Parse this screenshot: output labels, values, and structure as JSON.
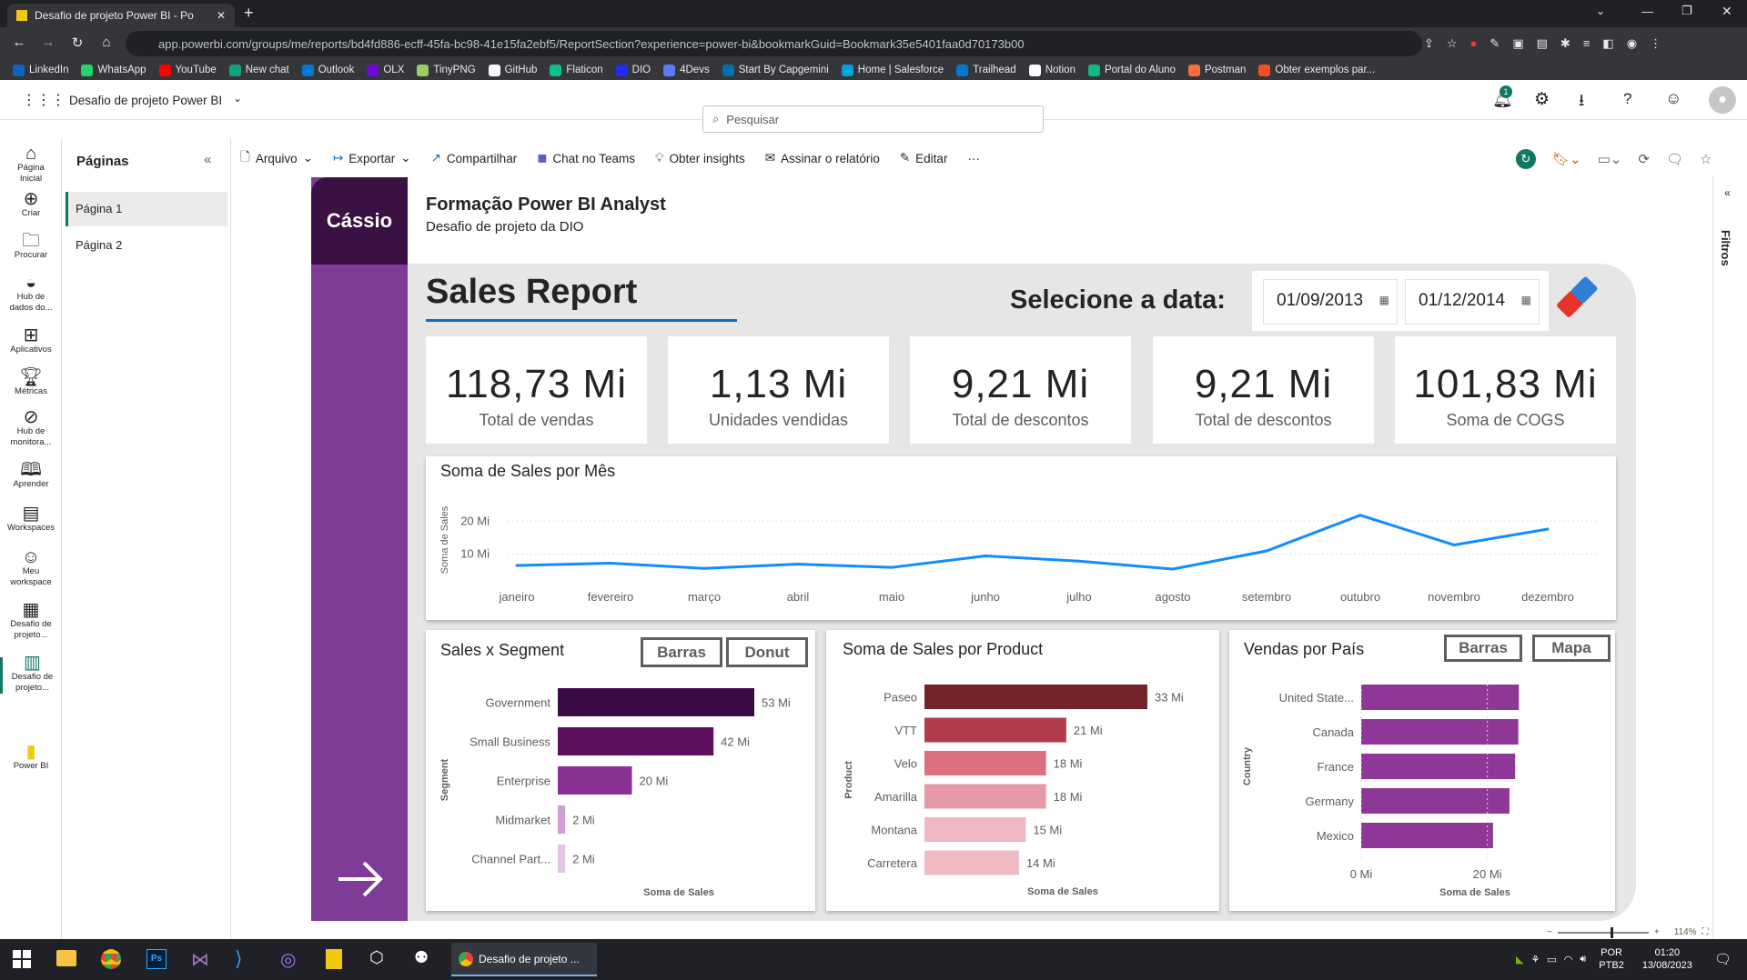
{
  "browser": {
    "tab_title": "Desafio de projeto Power BI - Po",
    "url": "app.powerbi.com/groups/me/reports/bd4fd886-ecff-45fa-bc98-41e15fa2ebf5/ReportSection?experience=power-bi&bookmarkGuid=Bookmark35e5401faa0d70173b00",
    "bookmarks": [
      "LinkedIn",
      "WhatsApp",
      "YouTube",
      "New chat",
      "Outlook",
      "OLX",
      "TinyPNG",
      "GitHub",
      "Flaticon",
      "DIO",
      "4Devs",
      "Start By Capgemini",
      "Home | Salesforce",
      "Trailhead",
      "Notion",
      "Portal do Aluno",
      "Postman",
      "Obter exemplos par..."
    ]
  },
  "pbi": {
    "workspace_title": "Desafio de projeto Power BI",
    "search_placeholder": "Pesquisar",
    "notif_count": "1"
  },
  "rail": [
    {
      "label": "Página Inicial",
      "icon": "home-icon"
    },
    {
      "label": "Criar",
      "icon": "plus-icon"
    },
    {
      "label": "Procurar",
      "icon": "folder-icon"
    },
    {
      "label": "Hub de dados do...",
      "icon": "datahub-icon"
    },
    {
      "label": "Aplicativos",
      "icon": "apps-icon"
    },
    {
      "label": "Métricas",
      "icon": "trophy-icon"
    },
    {
      "label": "Hub de monitora...",
      "icon": "monitor-icon"
    },
    {
      "label": "Aprender",
      "icon": "book-icon"
    },
    {
      "label": "Workspaces",
      "icon": "workspaces-icon"
    },
    {
      "label": "Meu workspace",
      "icon": "user-icon"
    },
    {
      "label": "Desafio de projeto...",
      "icon": "dataset-icon"
    },
    {
      "label": "Desafio de projeto...",
      "icon": "report-icon"
    },
    {
      "label": "Power BI",
      "icon": "powerbi-icon"
    }
  ],
  "pages_pane": {
    "title": "Páginas",
    "pages": [
      "Página 1",
      "Página 2"
    ]
  },
  "toolbar": {
    "arquivo": "Arquivo",
    "exportar": "Exportar",
    "compartilhar": "Compartilhar",
    "chat": "Chat no Teams",
    "insights": "Obter insights",
    "assinar": "Assinar o relatório",
    "editar": "Editar",
    "more": "···"
  },
  "report": {
    "logo_text": "Cássio",
    "header_title": "Formação Power BI Analyst",
    "header_subtitle": "Desafio de projeto da DIO",
    "title": "Sales Report",
    "date_label": "Selecione a data:",
    "date_start": "01/09/2013",
    "date_end": "01/12/2014",
    "kpis": [
      {
        "value": "118,73 Mi",
        "label": "Total de vendas"
      },
      {
        "value": "1,13 Mi",
        "label": "Unidades vendidas"
      },
      {
        "value": "9,21 Mi",
        "label": "Total de descontos"
      },
      {
        "value": "9,21 Mi",
        "label": "Total de descontos"
      },
      {
        "value": "101,83 Mi",
        "label": "Soma de COGS"
      }
    ],
    "btn_barras": "Barras",
    "btn_donut": "Donut",
    "btn_barras2": "Barras",
    "btn_mapa": "Mapa"
  },
  "chart_data": [
    {
      "type": "line",
      "title": "Soma de Sales por Mês",
      "ylabel": "Soma de Sales",
      "xlabel": "",
      "ytick_labels": [
        "10 Mi",
        "20 Mi"
      ],
      "ylim": [
        0,
        22
      ],
      "categories": [
        "janeiro",
        "fevereiro",
        "março",
        "abril",
        "maio",
        "junho",
        "julho",
        "agosto",
        "setembro",
        "outubro",
        "novembro",
        "dezembro"
      ],
      "values": [
        6.6,
        7.3,
        5.7,
        7.0,
        6.0,
        9.5,
        7.9,
        5.5,
        11.0,
        21.8,
        12.8,
        17.6
      ],
      "color": "#118dff"
    },
    {
      "type": "bar",
      "title": "Sales x Segment",
      "ylabel": "Segment",
      "xlabel": "Soma de Sales",
      "categories": [
        "Government",
        "Small Business",
        "Enterprise",
        "Midmarket",
        "Channel Part..."
      ],
      "values": [
        53,
        42,
        20,
        2,
        2
      ],
      "data_labels": [
        "53 Mi",
        "42 Mi",
        "20 Mi",
        "2 Mi",
        "2 Mi"
      ],
      "colors": [
        "#3b0a45",
        "#5b0f5c",
        "#8a3293",
        "#d29ed6",
        "#e3c5e6"
      ]
    },
    {
      "type": "bar",
      "title": "Soma de Sales por Product",
      "ylabel": "Product",
      "xlabel": "Soma de Sales",
      "categories": [
        "Paseo",
        "VTT",
        "Velo",
        "Amarilla",
        "Montana",
        "Carretera"
      ],
      "values": [
        33,
        21,
        18,
        18,
        15,
        14
      ],
      "data_labels": [
        "33 Mi",
        "21 Mi",
        "18 Mi",
        "18 Mi",
        "15 Mi",
        "14 Mi"
      ],
      "colors": [
        "#74232b",
        "#b33c4c",
        "#de6f7e",
        "#e69aa5",
        "#efb8c0",
        "#f0bcc3"
      ]
    },
    {
      "type": "bar",
      "title": "Vendas por País",
      "ylabel": "Country",
      "xlabel": "Soma de Sales",
      "categories": [
        "United State...",
        "Canada",
        "France",
        "Germany",
        "Mexico"
      ],
      "values": [
        25.0,
        24.9,
        24.4,
        23.5,
        20.9
      ],
      "xtick_labels": [
        "0 Mi",
        "20 Mi"
      ],
      "xlim": [
        0,
        30
      ],
      "color": "#8e3796"
    }
  ],
  "status": {
    "zoom": "114%"
  },
  "taskbar": {
    "app_label": "Desafio de projeto ...",
    "lang1": "POR",
    "lang2": "PTB2",
    "time": "01:20",
    "date": "13/08/2023"
  },
  "filters_label": "Filtros"
}
